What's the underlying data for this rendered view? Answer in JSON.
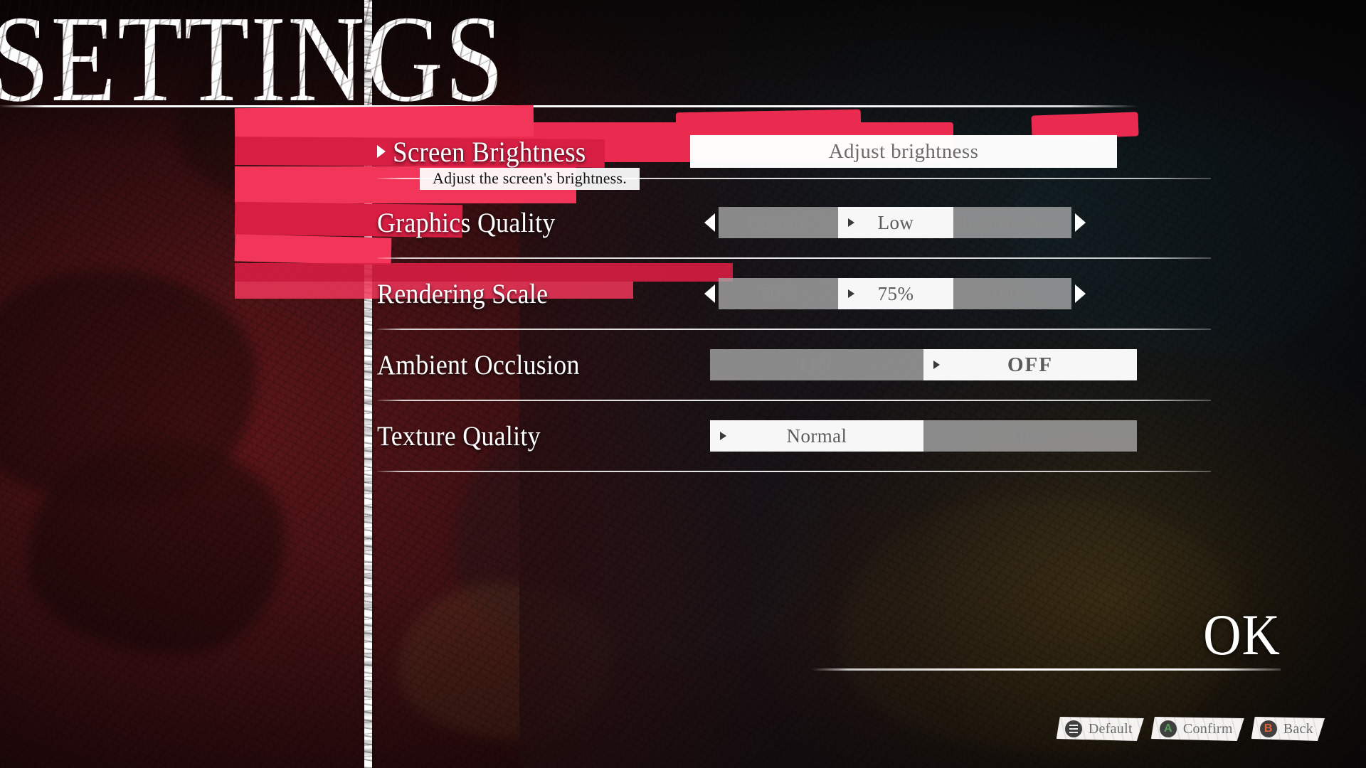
{
  "title": "SETTINGS",
  "menu": {
    "rows": [
      {
        "label": "Screen Brightness",
        "description": "Adjust the screen's brightness.",
        "type": "button",
        "button_label": "Adjust brightness",
        "selected": true
      },
      {
        "label": "Graphics Quality",
        "type": "options",
        "selected": false,
        "has_arrows": true,
        "options": [
          "Custom",
          "Low",
          "Intermediate"
        ],
        "selected_option": "Low",
        "selected_index": 1
      },
      {
        "label": "Rendering Scale",
        "type": "options",
        "selected": false,
        "has_arrows": true,
        "options": [
          "50%",
          "75%",
          "100%"
        ],
        "selected_option": "75%",
        "selected_index": 1
      },
      {
        "label": "Ambient Occlusion",
        "type": "options",
        "selected": false,
        "has_arrows": false,
        "options": [
          "ON",
          "OFF"
        ],
        "selected_option": "OFF",
        "selected_index": 1
      },
      {
        "label": "Texture Quality",
        "type": "options",
        "selected": false,
        "has_arrows": false,
        "options": [
          "Normal",
          "High"
        ],
        "selected_option": "Normal",
        "selected_index": 0
      }
    ]
  },
  "confirm": {
    "ok_label": "OK"
  },
  "prompts": [
    {
      "icon": "menu-icon",
      "glyph": "",
      "label": "Default",
      "color": "#3f3f3f"
    },
    {
      "icon": "button-a-icon",
      "glyph": "A",
      "label": "Confirm",
      "color": "#57a35c"
    },
    {
      "icon": "button-b-icon",
      "glyph": "B",
      "label": "Back",
      "color": "#e0643c"
    }
  ],
  "colors": {
    "highlight_red": "#ea2b4f",
    "panel_white": "#ffffff",
    "option_inactive": "#a8a8a8",
    "confirm_green": "#57a35c",
    "back_orange": "#e0643c",
    "bg_left": "#4a1215",
    "bg_right": "#111a20"
  }
}
